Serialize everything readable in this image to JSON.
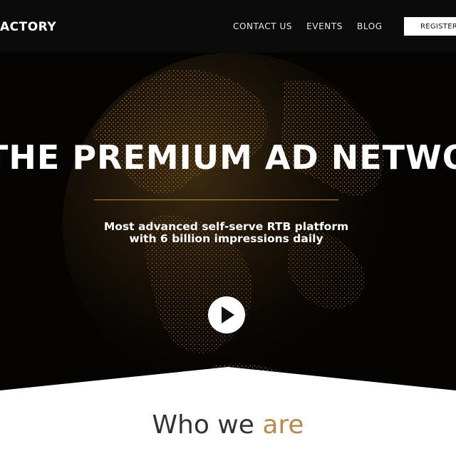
{
  "header": {
    "logo_text": "ACTORY",
    "nav": [
      {
        "label": "CONTACT US"
      },
      {
        "label": "EVENTS"
      },
      {
        "label": "BLOG"
      }
    ],
    "register_label": "REGISTER N"
  },
  "hero": {
    "title": "THE PREMIUM AD NETWORK",
    "subtitle_line1": "Most advanced self-serve RTB platform",
    "subtitle_line2": "with 6 billion impressions daily",
    "play_icon": "play-icon"
  },
  "who": {
    "heading_plain": "Who we ",
    "heading_accent": "are"
  },
  "colors": {
    "accent_gold": "#b88a4e",
    "header_bg": "#0b0b0b",
    "hero_bg": "#050403"
  }
}
